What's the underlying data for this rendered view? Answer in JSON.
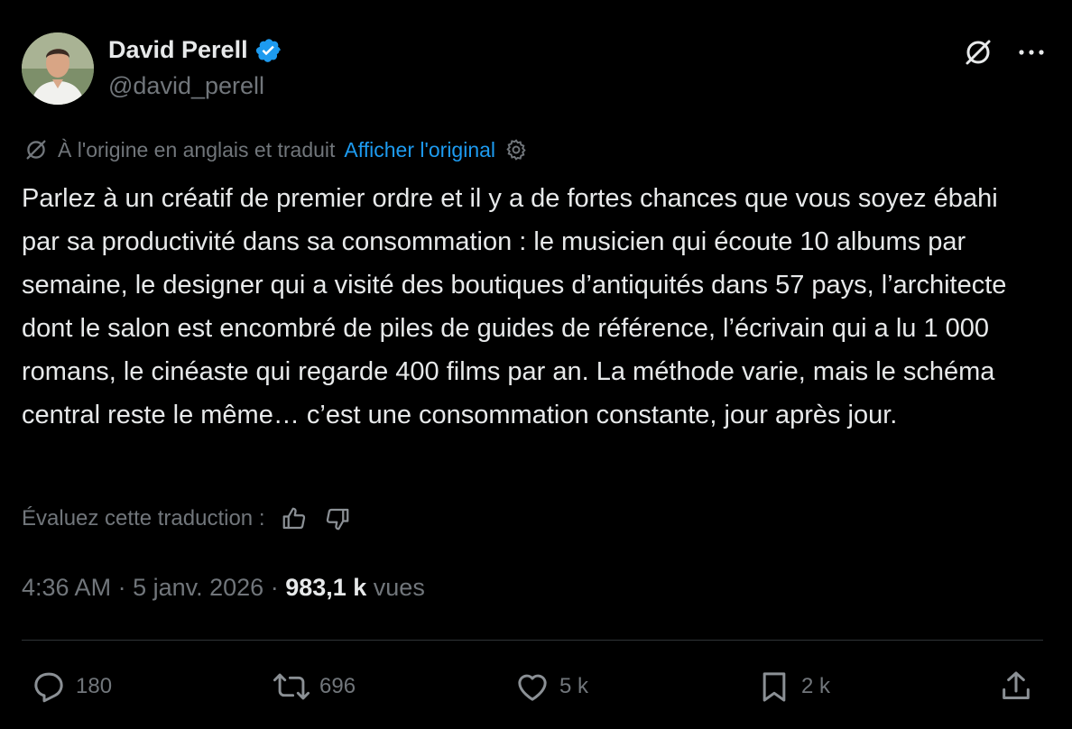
{
  "author": {
    "name": "David Perell",
    "handle": "@david_perell",
    "verified": true
  },
  "translation": {
    "notice": "À l'origine en anglais et traduit",
    "show_original": "Afficher l'original"
  },
  "tweet": {
    "text": "Parlez à un créatif de premier ordre et il y a de fortes chances que vous soyez ébahi par sa productivité dans sa consommation : le musicien qui écoute 10 albums par semaine, le designer qui a visité des boutiques d’antiquités dans 57 pays, l’architecte dont le salon est encombré de piles de guides de référence, l’écrivain qui a lu 1 000 romans, le cinéaste qui regarde 400 films par an. La méthode varie, mais le schéma central reste le même… c’est une consommation constante, jour après jour."
  },
  "rating": {
    "label": "Évaluez cette traduction :"
  },
  "meta": {
    "time": "4:36 AM",
    "sep1": " · ",
    "date": "5 janv. 2026",
    "sep2": " · ",
    "views_count": "983,1 k",
    "views_label": " vues"
  },
  "actions": {
    "replies": "180",
    "reposts": "696",
    "likes": "5 k",
    "bookmarks": "2 k"
  },
  "colors": {
    "background": "#000000",
    "text": "#e7e9ea",
    "muted": "#71767b",
    "accent": "#1d9bf0",
    "divider": "#2f3336"
  },
  "icons": [
    "verified-badge-icon",
    "translate-icon",
    "more-icon",
    "settings-icon",
    "thumbs-up-icon",
    "thumbs-down-icon",
    "reply-icon",
    "repost-icon",
    "like-icon",
    "bookmark-icon",
    "share-icon"
  ]
}
